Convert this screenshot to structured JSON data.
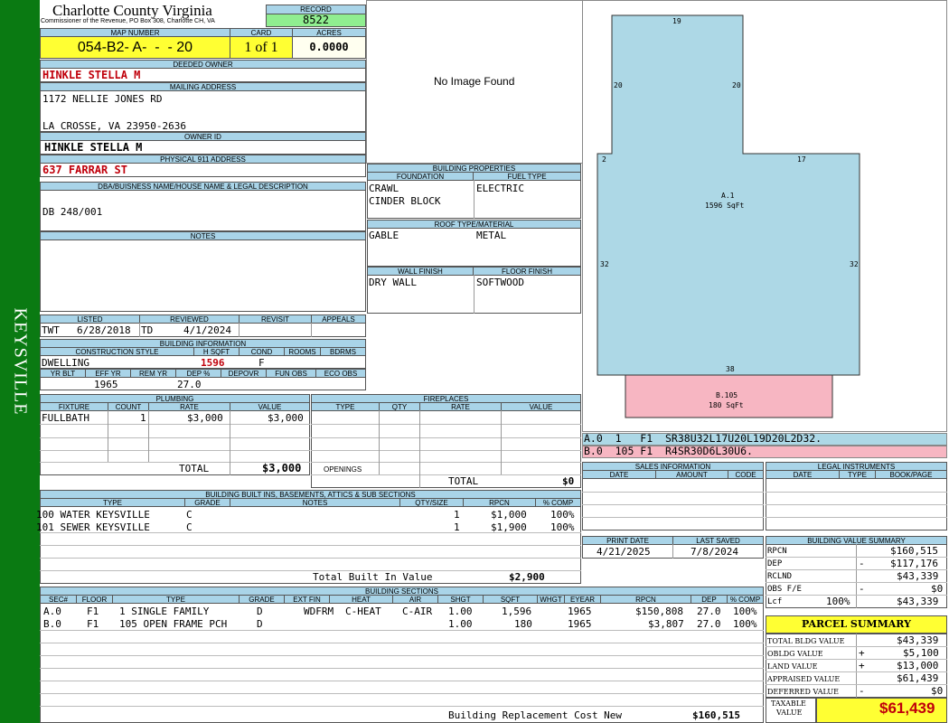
{
  "side_label": "KEYSVILLE",
  "county": {
    "name": "Charlotte County Virginia",
    "sub": "Commissioner of the Revenue, PO Box 308, Charlotte CH, VA"
  },
  "record": {
    "label": "RECORD",
    "value": "8522"
  },
  "map": {
    "label": "MAP NUMBER",
    "value": "054-B2- A-  -  - 20"
  },
  "card": {
    "label": "CARD",
    "value": "1 of 1"
  },
  "acres": {
    "label": "ACRES",
    "value": "0.0000"
  },
  "owner": {
    "label": "DEEDED OWNER",
    "value": "HINKLE STELLA M"
  },
  "mailing": {
    "label": "MAILING ADDRESS",
    "line1": "1172 NELLIE JONES RD",
    "line2": "LA CROSSE, VA 23950-2636"
  },
  "owner_id": {
    "label": "OWNER ID",
    "value": "HINKLE STELLA M"
  },
  "physical": {
    "label": "PHYSICAL 911 ADDRESS",
    "value": "637 FARRAR ST"
  },
  "dba": {
    "label": "DBA/BUISNESS NAME/HOUSE NAME & LEGAL DESCRIPTION",
    "value": "DB 248/001"
  },
  "notes": {
    "label": "NOTES"
  },
  "image": {
    "text": "No Image Found"
  },
  "status": {
    "listed_label": "LISTED",
    "reviewed_label": "REVIEWED",
    "revisit_label": "REVISIT",
    "appeals_label": "APPEALS",
    "listed_by": "TWT",
    "listed": "6/28/2018",
    "reviewed_by": "TD",
    "reviewed": "4/1/2024"
  },
  "building_info": {
    "label": "BUILDING INFORMATION",
    "h": {
      "style": "CONSTRUCTION STYLE",
      "hsqft": "H SQFT",
      "cond": "COND",
      "rooms": "ROOMS",
      "bdrms": "BDRMS",
      "yrblt": "YR BLT",
      "effyr": "EFF YR",
      "remyr": "REM YR",
      "dep": "DEP %",
      "depovr": "DEPOVR",
      "funobs": "FUN OBS",
      "ecoobs": "ECO OBS"
    },
    "style": "DWELLING",
    "hsqft": "1596",
    "cond": "F",
    "effyr": "1965",
    "dep": "27.0"
  },
  "props": {
    "label": "BUILDING PROPERTIES",
    "foundation_label": "FOUNDATION",
    "fuel_label": "FUEL TYPE",
    "foundation1": "CRAWL",
    "foundation2": "CINDER BLOCK",
    "fuel": "ELECTRIC",
    "roof_label": "ROOF TYPE/MATERIAL",
    "roof_type": "GABLE",
    "roof_mat": "METAL",
    "wall_label": "WALL FINISH",
    "floor_label": "FLOOR FINISH",
    "wall": "DRY WALL",
    "floor": "SOFTWOOD"
  },
  "sketch": {
    "a_label": "A.1",
    "a_area": "1596 SqFt",
    "b_label": "B.105",
    "b_area": "180 SqFt",
    "d19": "19",
    "d20l": "20",
    "d20r": "20",
    "d2": "2",
    "d17": "17",
    "d32l": "32",
    "d32r": "32",
    "d38": "38"
  },
  "vectors": {
    "a": "A.0  1   F1  SR38U32L17U20L19D20L2D32.",
    "b": "B.0  105 F1  R4SR30D6L30U6."
  },
  "plumbing": {
    "label": "PLUMBING",
    "h_fixture": "FIXTURE",
    "h_count": "COUNT",
    "h_rate": "RATE",
    "h_value": "VALUE",
    "fixture": "FULLBATH",
    "count": "1",
    "rate": "$3,000",
    "value": "$3,000",
    "total_label": "TOTAL",
    "total": "$3,000"
  },
  "fireplaces": {
    "label": "FIREPLACES",
    "h_type": "TYPE",
    "h_qty": "QTY",
    "h_rate": "RATE",
    "h_value": "VALUE",
    "openings": "OPENINGS",
    "total_label": "TOTAL",
    "total": "$0"
  },
  "sales": {
    "label": "SALES INFORMATION",
    "h_date": "DATE",
    "h_amount": "AMOUNT",
    "h_code": "CODE"
  },
  "legal": {
    "label": "LEGAL INSTRUMENTS",
    "h_date": "DATE",
    "h_type": "TYPE",
    "h_book": "BOOK/PAGE"
  },
  "dates": {
    "print_label": "PRINT DATE",
    "saved_label": "LAST SAVED",
    "print": "4/21/2025",
    "saved": "7/8/2024"
  },
  "builtins": {
    "label": "BUILDING BUILT INS, BASEMENTS, ATTICS & SUB SECTIONS",
    "h": [
      "TYPE",
      "GRADE",
      "NOTES",
      "QTY/SIZE",
      "RPCN",
      "% COMP"
    ],
    "rows": [
      [
        "100 WATER KEYSVILLE",
        "C",
        "",
        "1",
        "$1,000",
        "100%"
      ],
      [
        "101 SEWER KEYSVILLE",
        "C",
        "",
        "1",
        "$1,900",
        "100%"
      ]
    ],
    "total_label": "Total Built In Value",
    "total": "$2,900"
  },
  "sections": {
    "label": "BUILDING SECTIONS",
    "h": [
      "SEC#",
      "FLOOR",
      "TYPE",
      "GRADE",
      "EXT FIN",
      "HEAT",
      "AIR",
      "SHGT",
      "SQFT",
      "WHGT",
      "EYEAR",
      "RPCN",
      "DEP",
      "% COMP"
    ],
    "rows": [
      [
        "A.0",
        "F1",
        "1 SINGLE FAMILY",
        "D",
        "WDFRM",
        "C-HEAT",
        "C-AIR",
        "1.00",
        "1,596",
        "",
        "1965",
        "$150,808",
        "27.0",
        "100%"
      ],
      [
        "B.0",
        "F1",
        "105 OPEN FRAME PCH",
        "D",
        "",
        "",
        "",
        "1.00",
        "180",
        "",
        "1965",
        "$3,807",
        "27.0",
        "100%"
      ]
    ],
    "total_label": "Building Replacement Cost New",
    "total": "$160,515"
  },
  "value_summary": {
    "label": "BUILDING VALUE SUMMARY",
    "rpcn_label": "RPCN",
    "rpcn": "$160,515",
    "dep_label": "DEP",
    "dep_sign": "-",
    "dep": "$117,176",
    "rclnd_label": "RCLND",
    "rclnd": "$43,339",
    "obs_label": "OBS F/E",
    "obs_sign": "-",
    "obs": "$0",
    "lcf_label": "Lcf",
    "lcf_pct": "100%",
    "lcf": "$43,339"
  },
  "parcel": {
    "label": "PARCEL SUMMARY",
    "total_bldg_label": "TOTAL BLDG VALUE",
    "total_bldg": "$43,339",
    "obldg_label": "OBLDG VALUE",
    "obldg_sign": "+",
    "obldg": "$5,100",
    "land_label": "LAND VALUE",
    "land_sign": "+",
    "land": "$13,000",
    "appraised_label": "APPRAISED VALUE",
    "appraised": "$61,439",
    "deferred_label": "DEFERRED VALUE",
    "deferred_sign": "-",
    "deferred": "$0",
    "taxable_label1": "TAXABLE",
    "taxable_label2": "VALUE",
    "taxable": "$61,439"
  },
  "colors": {
    "side": "#0a7a12",
    "header": "#a9d4e8",
    "yellow": "#ffff33",
    "green": "#90ee90",
    "sketch_a": "#add8e6",
    "sketch_b": "#f7b6c2",
    "red": "#c0000b"
  }
}
